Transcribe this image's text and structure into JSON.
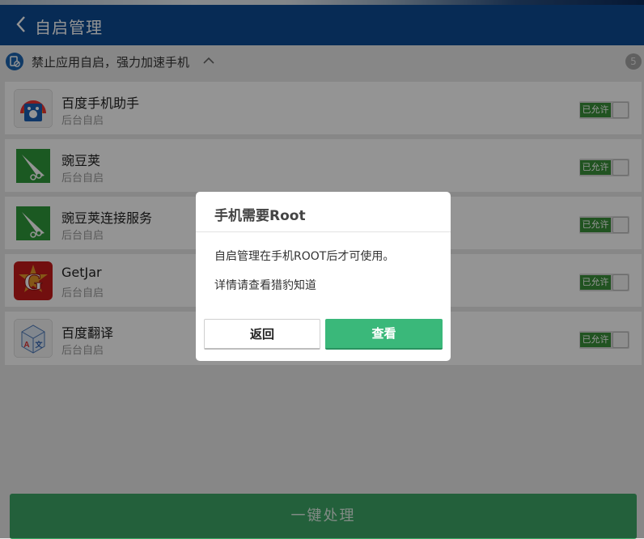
{
  "header": {
    "title": "自启管理"
  },
  "subheader": {
    "text": "禁止应用自启，强力加速手机",
    "count": "5"
  },
  "apps": [
    {
      "name": "百度手机助手",
      "sub": "后台自启",
      "toggle": "已允许",
      "icon": "baidu-assistant-icon"
    },
    {
      "name": "豌豆荚",
      "sub": "后台自启",
      "toggle": "已允许",
      "icon": "wandoujia-icon"
    },
    {
      "name": "豌豆荚连接服务",
      "sub": "后台自启",
      "toggle": "已允许",
      "icon": "wandoujia-connect-icon"
    },
    {
      "name": "GetJar",
      "sub": "后台自启",
      "toggle": "已允许",
      "icon": "getjar-icon"
    },
    {
      "name": "百度翻译",
      "sub": "后台自启",
      "toggle": "已允许",
      "icon": "baidu-translate-icon"
    }
  ],
  "bottom_button": "一键处理",
  "dialog": {
    "title": "手机需要Root",
    "message1": "自启管理在手机ROOT后才可使用。",
    "message2": "详情请查看猎豹知道",
    "cancel": "返回",
    "confirm": "查看"
  },
  "colors": {
    "header_bg": "#0d4a93",
    "toggle_on": "#3a8f3a",
    "primary_button": "#3ab87a",
    "bottom_button": "#3da666"
  }
}
